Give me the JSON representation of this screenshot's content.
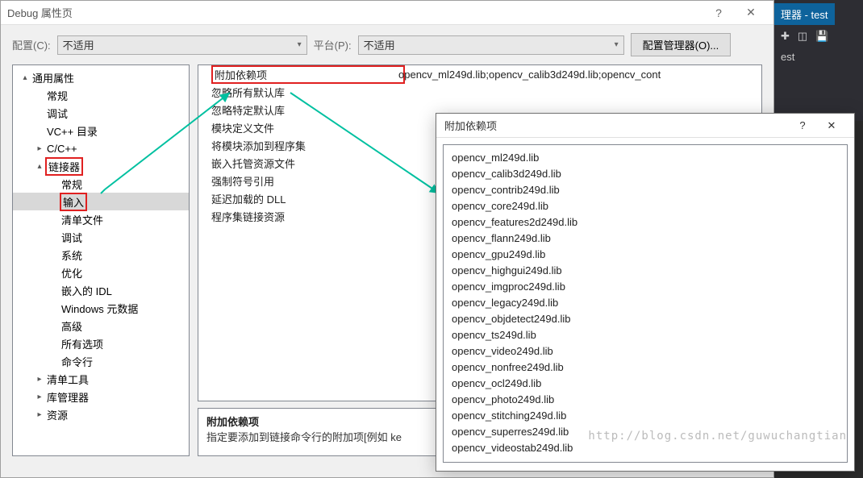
{
  "dialog": {
    "title": "Debug 属性页",
    "help": "?",
    "close": "✕"
  },
  "config": {
    "label": "配置(C):",
    "value": "不适用",
    "platform_label": "平台(P):",
    "platform_value": "不适用",
    "manager_btn": "配置管理器(O)..."
  },
  "tree": [
    {
      "ind": 0,
      "arrow": "▴",
      "label": "通用属性",
      "hl": false
    },
    {
      "ind": 1,
      "arrow": "",
      "label": "常规",
      "hl": false
    },
    {
      "ind": 1,
      "arrow": "",
      "label": "调试",
      "hl": false
    },
    {
      "ind": 1,
      "arrow": "",
      "label": "VC++ 目录",
      "hl": false
    },
    {
      "ind": 1,
      "arrow": "▸",
      "label": "C/C++",
      "hl": false
    },
    {
      "ind": 1,
      "arrow": "▴",
      "label": "链接器",
      "hl": true
    },
    {
      "ind": 2,
      "arrow": "",
      "label": "常规",
      "hl": false
    },
    {
      "ind": 2,
      "arrow": "",
      "label": "输入",
      "hl": true,
      "sel": true
    },
    {
      "ind": 2,
      "arrow": "",
      "label": "清单文件",
      "hl": false
    },
    {
      "ind": 2,
      "arrow": "",
      "label": "调试",
      "hl": false
    },
    {
      "ind": 2,
      "arrow": "",
      "label": "系统",
      "hl": false
    },
    {
      "ind": 2,
      "arrow": "",
      "label": "优化",
      "hl": false
    },
    {
      "ind": 2,
      "arrow": "",
      "label": "嵌入的 IDL",
      "hl": false
    },
    {
      "ind": 2,
      "arrow": "",
      "label": "Windows 元数据",
      "hl": false
    },
    {
      "ind": 2,
      "arrow": "",
      "label": "高级",
      "hl": false
    },
    {
      "ind": 2,
      "arrow": "",
      "label": "所有选项",
      "hl": false
    },
    {
      "ind": 2,
      "arrow": "",
      "label": "命令行",
      "hl": false
    },
    {
      "ind": 1,
      "arrow": "▸",
      "label": "清单工具",
      "hl": false
    },
    {
      "ind": 1,
      "arrow": "▸",
      "label": "库管理器",
      "hl": false
    },
    {
      "ind": 1,
      "arrow": "▸",
      "label": "资源",
      "hl": false
    }
  ],
  "grid": [
    {
      "key": "附加依赖项",
      "val": "opencv_ml249d.lib;opencv_calib3d249d.lib;opencv_cont",
      "hl": true
    },
    {
      "key": "忽略所有默认库",
      "val": ""
    },
    {
      "key": "忽略特定默认库",
      "val": ""
    },
    {
      "key": "模块定义文件",
      "val": ""
    },
    {
      "key": "将模块添加到程序集",
      "val": ""
    },
    {
      "key": "嵌入托管资源文件",
      "val": ""
    },
    {
      "key": "强制符号引用",
      "val": ""
    },
    {
      "key": "延迟加载的 DLL",
      "val": ""
    },
    {
      "key": "程序集链接资源",
      "val": ""
    }
  ],
  "desc": {
    "title": "附加依赖项",
    "text": "指定要添加到链接命令行的附加项[例如 ke"
  },
  "popup": {
    "title": "附加依赖项",
    "help": "?",
    "close": "✕",
    "lines": [
      "opencv_ml249d.lib",
      "opencv_calib3d249d.lib",
      "opencv_contrib249d.lib",
      "opencv_core249d.lib",
      "opencv_features2d249d.lib",
      "opencv_flann249d.lib",
      "opencv_gpu249d.lib",
      "opencv_highgui249d.lib",
      "opencv_imgproc249d.lib",
      "opencv_legacy249d.lib",
      "opencv_objdetect249d.lib",
      "opencv_ts249d.lib",
      "opencv_video249d.lib",
      "opencv_nonfree249d.lib",
      "opencv_ocl249d.lib",
      "opencv_photo249d.lib",
      "opencv_stitching249d.lib",
      "opencv_superres249d.lib",
      "opencv_videostab249d.lib"
    ]
  },
  "bg": {
    "tab": "理器 - test",
    "est": "est"
  },
  "watermark": "http://blog.csdn.net/guwuchangtian"
}
